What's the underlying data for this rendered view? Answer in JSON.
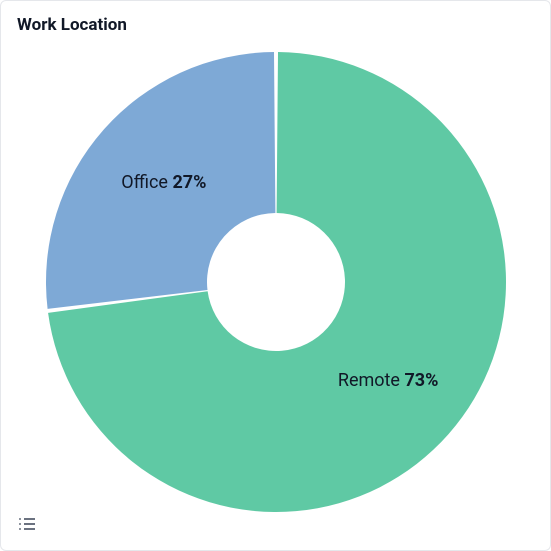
{
  "card": {
    "title": "Work Location"
  },
  "chart_data": {
    "type": "pie",
    "title": "Work Location",
    "series": [
      {
        "name": "Remote",
        "value": 73,
        "color": "#5fc9a4"
      },
      {
        "name": "Office",
        "value": 27,
        "color": "#7ea9d6"
      }
    ],
    "value_suffix": "%",
    "donut_inner_radius_pct": 30,
    "start_angle_deg": 0,
    "gap_deg": 1
  },
  "legend_toggle": {
    "aria_label": "Toggle legend"
  }
}
